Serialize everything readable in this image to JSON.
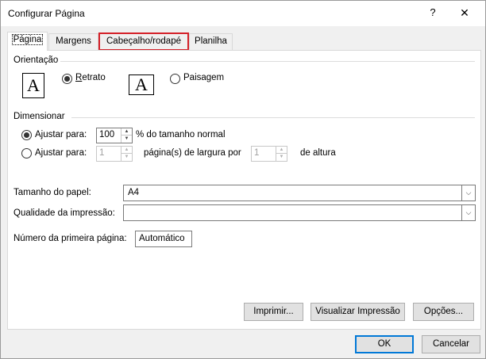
{
  "window": {
    "title": "Configurar Página",
    "help_label": "?",
    "close_label": "✕"
  },
  "tabs": [
    {
      "label": "Página",
      "active": true
    },
    {
      "label": "Margens",
      "active": false
    },
    {
      "label": "Cabeçalho/rodapé",
      "active": false,
      "highlighted": true
    },
    {
      "label": "Planilha",
      "active": false
    }
  ],
  "orientation": {
    "group_label": "Orientação",
    "portrait_label": "Retrato",
    "landscape_label": "Paisagem",
    "selected": "portrait",
    "icon_glyph": "A"
  },
  "scaling": {
    "group_label": "Dimensionar",
    "adjust_to_label": "Ajustar para:",
    "adjust_to_value": "100",
    "adjust_to_suffix": "% do tamanho normal",
    "fit_to_label": "Ajustar para:",
    "fit_wide_value": "1",
    "fit_wide_suffix": "página(s) de largura por",
    "fit_tall_value": "1",
    "fit_tall_suffix": "de altura",
    "selected": "adjust_to"
  },
  "paper": {
    "size_label": "Tamanho do papel:",
    "size_value": "A4",
    "quality_label": "Qualidade da impressão:",
    "quality_value": "",
    "first_page_label": "Número da primeira página:",
    "first_page_value": "Automático"
  },
  "actions": {
    "print_label": "Imprimir...",
    "preview_label": "Visualizar Impressão",
    "options_label": "Opções..."
  },
  "footer": {
    "ok_label": "OK",
    "cancel_label": "Cancelar"
  },
  "colors": {
    "highlight_border": "#d42028",
    "default_button_border": "#0078d7"
  }
}
